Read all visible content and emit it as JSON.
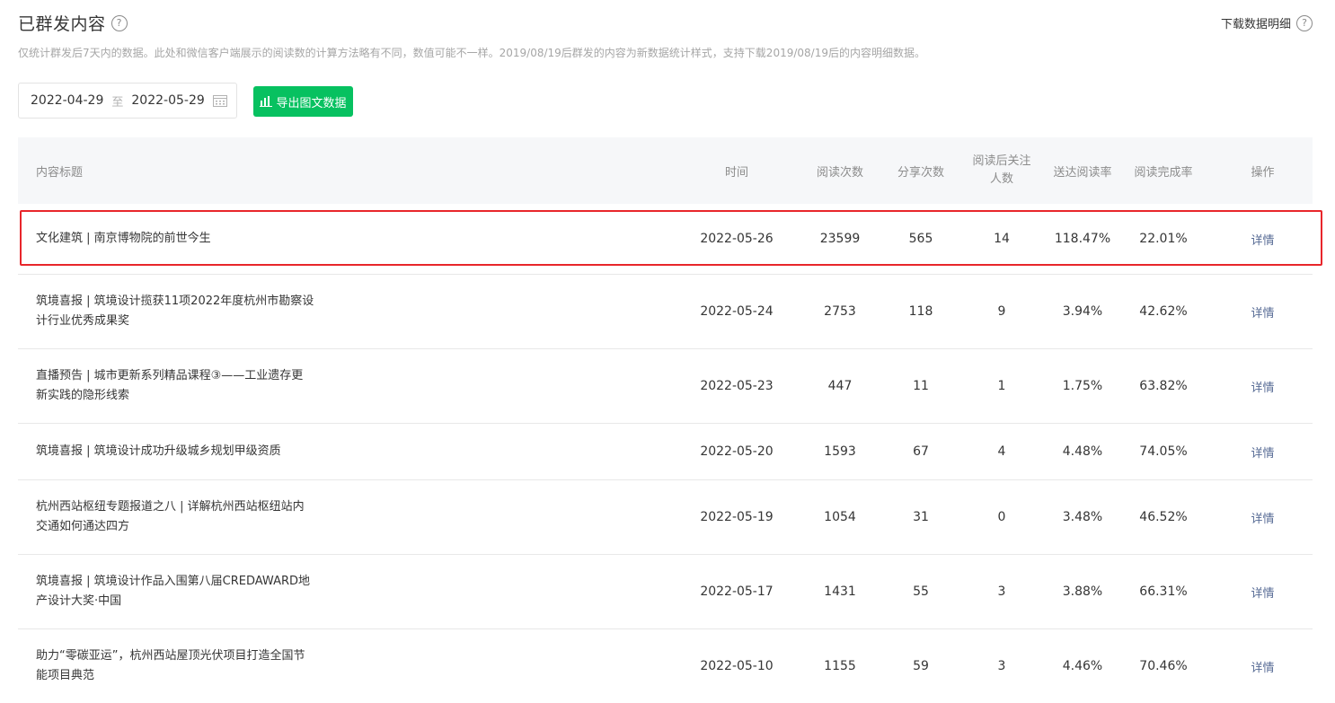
{
  "header": {
    "title": "已群发内容",
    "help_icon": "?",
    "download_label": "下载数据明细"
  },
  "notice": "仅统计群发后7天内的数据。此处和微信客户端展示的阅读数的计算方法略有不同，数值可能不一样。2019/08/19后群发的内容为新数据统计样式，支持下载2019/08/19后的内容明细数据。",
  "date_range": {
    "start": "2022-04-29",
    "separator": "至",
    "end": "2022-05-29",
    "icon": "calendar-icon"
  },
  "export_button": {
    "label": "导出图文数据",
    "icon": "bar-chart-icon"
  },
  "table": {
    "headers": {
      "title": "内容标题",
      "time": "时间",
      "reads": "阅读次数",
      "shares": "分享次数",
      "follows": "阅读后关注人数",
      "reach_rate": "送达阅读率",
      "complete_rate": "阅读完成率",
      "op": "操作"
    },
    "rows": [
      {
        "title": "文化建筑 | 南京博物院的前世今生",
        "time": "2022-05-26",
        "reads": "23599",
        "shares": "565",
        "follows": "14",
        "reach_rate": "118.47%",
        "complete_rate": "22.01%",
        "op": "详情"
      },
      {
        "title": "筑境喜报 | 筑境设计揽获11项2022年度杭州市勘察设计行业优秀成果奖",
        "time": "2022-05-24",
        "reads": "2753",
        "shares": "118",
        "follows": "9",
        "reach_rate": "3.94%",
        "complete_rate": "42.62%",
        "op": "详情"
      },
      {
        "title": "直播预告 | 城市更新系列精品课程③——工业遗存更新实践的隐形线索",
        "time": "2022-05-23",
        "reads": "447",
        "shares": "11",
        "follows": "1",
        "reach_rate": "1.75%",
        "complete_rate": "63.82%",
        "op": "详情"
      },
      {
        "title": "筑境喜报 | 筑境设计成功升级城乡规划甲级资质",
        "time": "2022-05-20",
        "reads": "1593",
        "shares": "67",
        "follows": "4",
        "reach_rate": "4.48%",
        "complete_rate": "74.05%",
        "op": "详情"
      },
      {
        "title": "杭州西站枢纽专题报道之八 | 详解杭州西站枢纽站内交通如何通达四方",
        "time": "2022-05-19",
        "reads": "1054",
        "shares": "31",
        "follows": "0",
        "reach_rate": "3.48%",
        "complete_rate": "46.52%",
        "op": "详情"
      },
      {
        "title": "筑境喜报 | 筑境设计作品入围第八届CREDAWARD地产设计大奖·中国",
        "time": "2022-05-17",
        "reads": "1431",
        "shares": "55",
        "follows": "3",
        "reach_rate": "3.88%",
        "complete_rate": "66.31%",
        "op": "详情"
      },
      {
        "title": "助力“零碳亚运”，杭州西站屋顶光伏项目打造全国节能项目典范",
        "time": "2022-05-10",
        "reads": "1155",
        "shares": "59",
        "follows": "3",
        "reach_rate": "4.46%",
        "complete_rate": "70.46%",
        "op": "详情"
      }
    ]
  },
  "colors": {
    "accent_green": "#07c160",
    "link_blue": "#576b95",
    "highlight_red": "#e8262b"
  }
}
